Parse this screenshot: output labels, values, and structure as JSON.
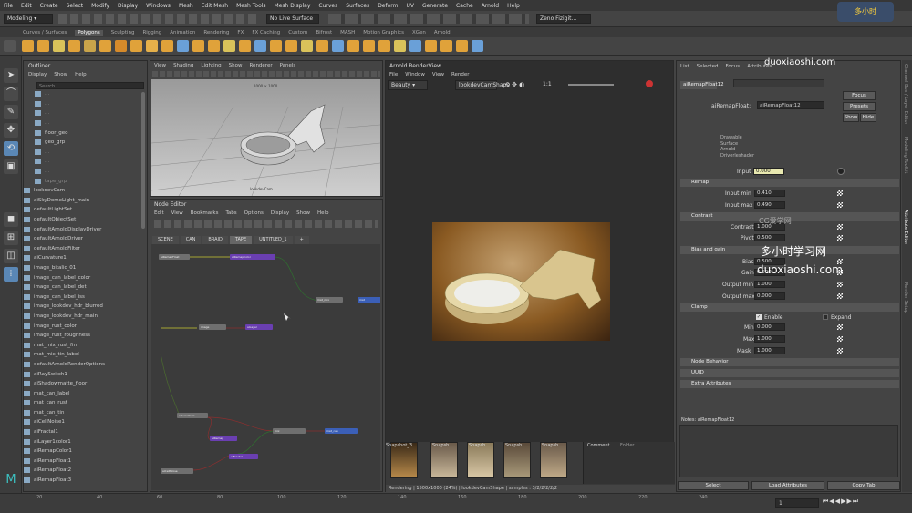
{
  "menu": [
    "File",
    "Edit",
    "Create",
    "Select",
    "Modify",
    "Display",
    "Windows",
    "Mesh",
    "Edit Mesh",
    "Mesh Tools",
    "Mesh Display",
    "Curves",
    "Surfaces",
    "Deform",
    "UV",
    "Generate",
    "Cache",
    "Arnold",
    "Help"
  ],
  "status": {
    "mode": "Modeling",
    "live": "No Live Surface",
    "cam_field": "Zeno Fizigit..."
  },
  "shelf_tabs": [
    "Curves / Surfaces",
    "Polygons",
    "Sculpting",
    "Rigging",
    "Animation",
    "Rendering",
    "FX",
    "FX Caching",
    "Custom",
    "Bifrost",
    "MASH",
    "Motion Graphics",
    "XGen",
    "Arnold"
  ],
  "shelf_tab_active": "Polygons",
  "outliner": {
    "title": "Outliner",
    "menu": [
      "Display",
      "Show",
      "Help"
    ],
    "search": "Search...",
    "items": [
      {
        "l": "...",
        "d": true
      },
      {
        "l": "...",
        "d": true
      },
      {
        "l": "...",
        "d": true
      },
      {
        "l": "...",
        "d": true
      },
      {
        "l": "floor_geo",
        "d": false
      },
      {
        "l": "geo_grp",
        "d": false
      },
      {
        "l": "...",
        "d": true
      },
      {
        "l": "...",
        "d": true
      },
      {
        "l": "...",
        "d": true
      },
      {
        "l": "tape_grp",
        "d": true
      },
      {
        "l": "lookdevCam",
        "d": false
      },
      {
        "l": "aiSkyDomeLight_main",
        "d": false
      },
      {
        "l": "defaultLightSet",
        "d": false
      },
      {
        "l": "defaultObjectSet",
        "d": false
      },
      {
        "l": "defaultArnoldDisplayDriver",
        "d": false
      },
      {
        "l": "defaultArnoldDriver",
        "d": false
      },
      {
        "l": "defaultArnoldFilter",
        "d": false
      },
      {
        "l": "aiCurvature1",
        "d": false
      },
      {
        "l": "image_bitalic_01",
        "d": false
      },
      {
        "l": "image_can_label_color",
        "d": false
      },
      {
        "l": "image_can_label_det",
        "d": false
      },
      {
        "l": "image_can_label_iss",
        "d": false
      },
      {
        "l": "image_lookdev_hdr_blurred",
        "d": false
      },
      {
        "l": "image_lookdev_hdr_main",
        "d": false
      },
      {
        "l": "image_rust_color",
        "d": false
      },
      {
        "l": "image_rust_roughness",
        "d": false
      },
      {
        "l": "mat_mix_rust_fin",
        "d": false
      },
      {
        "l": "mat_mix_tin_label",
        "d": false
      },
      {
        "l": "defaultArnoldRenderOptions",
        "d": false
      },
      {
        "l": "aiRaySwitch1",
        "d": false
      },
      {
        "l": "aiShadowmatte_floor",
        "d": false
      },
      {
        "l": "mat_can_label",
        "d": false
      },
      {
        "l": "mat_can_rust",
        "d": false
      },
      {
        "l": "mat_can_tin",
        "d": false
      },
      {
        "l": "aiCellNoise1",
        "d": false
      },
      {
        "l": "aiFractal1",
        "d": false
      },
      {
        "l": "aiLayer1color1",
        "d": false
      },
      {
        "l": "aiRemapColor1",
        "d": false
      },
      {
        "l": "aiRemapFloat1",
        "d": false
      },
      {
        "l": "aiRemapFloat2",
        "d": false
      },
      {
        "l": "aiRemapFloat3",
        "d": false
      }
    ]
  },
  "viewport": {
    "menu": [
      "View",
      "Shading",
      "Lighting",
      "Show",
      "Renderer",
      "Panels"
    ],
    "res": "1000 × 1000",
    "cam": "lookdevCam"
  },
  "node_editor": {
    "title": "Node Editor",
    "menu": [
      "Edit",
      "View",
      "Bookmarks",
      "Tabs",
      "Options",
      "Display",
      "Show",
      "Help"
    ],
    "tabs": [
      "SCENE",
      "CAN",
      "BRAID",
      "TAPE",
      "UNTITLED_1",
      "+"
    ],
    "active_tab": "TAPE"
  },
  "render_view": {
    "title": "Arnold RenderView",
    "menu": [
      "File",
      "Window",
      "View",
      "Render"
    ],
    "aov": "Beauty",
    "camera": "lookdevCamShape",
    "ratio": "1:1",
    "snapshots_label": "Snapshot_3",
    "snap_short": "Snapsh",
    "comment_tab": "Comment",
    "folder_tab": "Folder",
    "status": "Rendering | 1500x1000 (24%) | lookdevCamShape | samples : 3/2/2/2/2/2"
  },
  "attr": {
    "tabs": [
      "List",
      "Selected",
      "Focus",
      "Attributes"
    ],
    "node": "aiRemapFloat12",
    "type_field": "aiRemapFloat12",
    "type_label": "aiRemapFloat:",
    "focus": "Focus",
    "presets": "Presets",
    "show": "Show",
    "hide": "Hide",
    "derived": [
      "Drawable",
      "Surface",
      "Arnold",
      "Driverleshader"
    ],
    "input_label": "Input",
    "input_val": "0.000",
    "remap": "Remap",
    "input_min_l": "Input min",
    "input_min": "0.410",
    "input_max_l": "Input max",
    "input_max": "0.490",
    "contrast_s": "Contrast",
    "contrast_l": "Contrast",
    "contrast": "1.000",
    "pivot_l": "Pivot",
    "pivot": "0.500",
    "bias_s": "Bias and gain",
    "bias_l": "Bias",
    "bias": "0.500",
    "gain_l": "Gain",
    "gain": "0.500",
    "out_min_l": "Output min",
    "out_min": "1.000",
    "out_max_l": "Output max",
    "out_max": "0.000",
    "clamp_s": "Clamp",
    "enable": "Enable",
    "expand": "Expand",
    "min_l": "Min",
    "min": "0.000",
    "max_l": "Max",
    "max": "1.000",
    "mask_l": "Mask",
    "mask": "1.000",
    "node_behavior": "Node Behavior",
    "uuid": "UUID",
    "extra": "Extra Attributes",
    "notes_label": "Notes: aiRemapFloat12",
    "select": "Select",
    "load": "Load Attributes",
    "copy": "Copy Tab"
  },
  "right_tabs": [
    "Channel Box / Layer Editor",
    "Modeling Toolkit",
    "Attribute Editor",
    "Render Setup"
  ],
  "timeline": {
    "ticks": [
      "20",
      "40",
      "60",
      "80",
      "100",
      "120",
      "140",
      "160",
      "180",
      "200",
      "220",
      "240"
    ],
    "frame": "1"
  },
  "watermark": {
    "brand": "多小时学习网",
    "site": "duoxiaoshi.com",
    "site2": "duoxiaoshi.com",
    "cg": "CG爱学网",
    "badge": "多小时"
  },
  "colors": {
    "accent": "#5aa0d8",
    "render_bg": "#6b4a1f"
  }
}
